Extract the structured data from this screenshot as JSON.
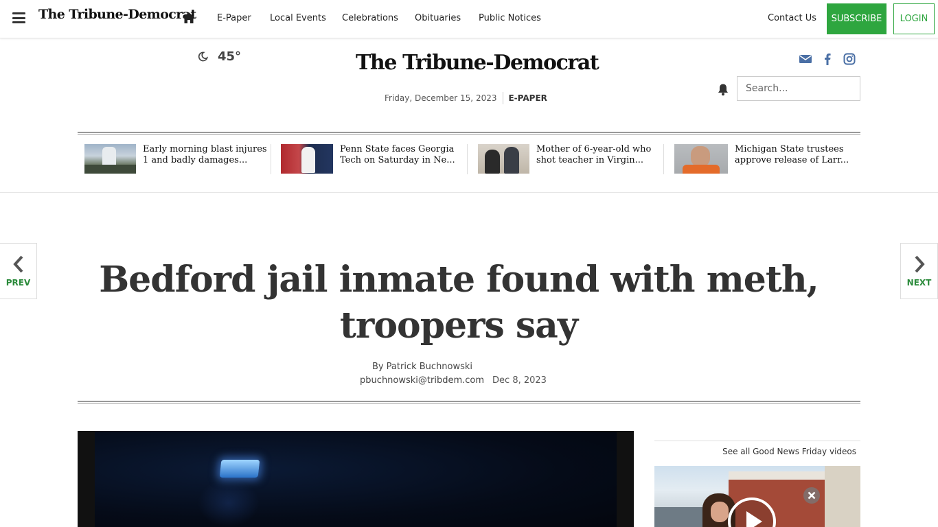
{
  "topnav": {
    "logo": "The Tribune-Democrat",
    "links": [
      "E-Paper",
      "Local Events",
      "Celebrations",
      "Obituaries",
      "Public Notices"
    ],
    "contact": "Contact Us",
    "subscribe": "SUBSCRIBE",
    "login": "LOGIN"
  },
  "masthead": {
    "temperature": "45°",
    "logo": "The Tribune-Democrat",
    "date": "Friday, December 15, 2023",
    "epaper": "E-PAPER",
    "search_placeholder": "Search..."
  },
  "trending": [
    {
      "title": "Early morning blast injures 1 and badly damages..."
    },
    {
      "title": "Penn State faces Georgia Tech on Saturday in Ne..."
    },
    {
      "title": "Mother of 6-year-old who shot teacher in Virgin..."
    },
    {
      "title": "Michigan State trustees approve release of Larr..."
    }
  ],
  "pager": {
    "prev": "PREV",
    "next": "NEXT"
  },
  "article": {
    "headline": "Bedford jail inmate found with meth, troopers say",
    "author": "By Patrick Buchnowski",
    "email": "pbuchnowski@tribdem.com",
    "date": "Dec 8, 2023"
  },
  "sidebar": {
    "see_all": "See all Good News Friday videos"
  },
  "colors": {
    "accent": "#2ea63f",
    "social": "#4a6fa5"
  }
}
